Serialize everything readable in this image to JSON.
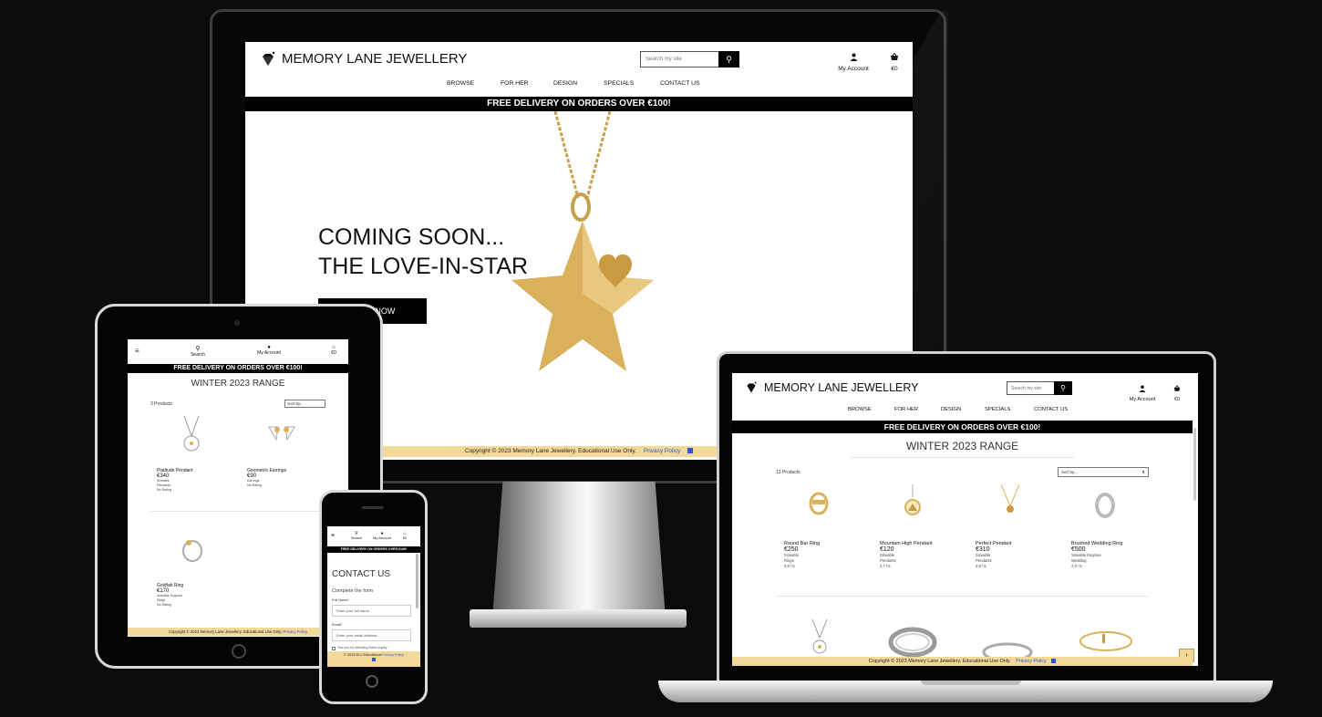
{
  "desktop": {
    "brand": "MEMORY LANE JEWELLERY",
    "search_placeholder": "Search my site",
    "account_label": "My Account",
    "cart_total": "€0",
    "nav": [
      "BROWSE",
      "FOR HER",
      "DESIGN",
      "SPECIALS",
      "CONTACT US"
    ],
    "banner": "FREE DELIVERY ON ORDERS OVER €100!",
    "hero_line1": "COMING SOON...",
    "hero_line2": "THE LOVE-IN-STAR",
    "hero_button": "SHOP NOW",
    "footer_text": "Copyright © 2023 Memory Lane Jewellery.  Educational Use Only.",
    "footer_link": "Privacy Policy"
  },
  "tablet": {
    "search_label": "Search",
    "account_label": "My Account",
    "cart_total": "€0",
    "banner": "FREE DELIVERY ON ORDERS OVER €100!",
    "heading": "WINTER 2023 RANGE",
    "product_count": "3 Products",
    "sort_label": "Sort by...",
    "products": [
      {
        "name": "Platitude Pendant",
        "price": "€340",
        "tags1": "Sizeable",
        "tags2": "Pendants",
        "rating": "No Rating"
      },
      {
        "name": "Geometric Earrings",
        "price": "€90",
        "tags1": "",
        "tags2": "Earrings",
        "rating": "No Rating"
      },
      {
        "name": "Goldfab Ring",
        "price": "€170",
        "tags1": "Sizeable Engrave",
        "tags2": "Rings",
        "rating": "No Rating"
      }
    ],
    "footer_text": "Copyright © 2023 Memory Lane Jewellery.  Educational Use Only.",
    "footer_link": "Privacy Policy"
  },
  "phone": {
    "search_label": "Search",
    "account_label": "My Account",
    "cart_total": "€0",
    "banner": "FREE DELIVERY ON ORDERS OVER €100!",
    "heading": "CONTACT US",
    "subheading": "Complete the form",
    "name_label": "Full Name*",
    "name_placeholder": "Enter your full name",
    "email_label": "Email*",
    "email_placeholder": "Enter your email address",
    "checkbox_label": "Tick box for Wedding Band inquiry",
    "footer_text": "© 2023 MLJ Educational",
    "footer_link": "Privacy Policy"
  },
  "laptop": {
    "brand": "MEMORY LANE JEWELLERY",
    "search_placeholder": "Search my site",
    "account_label": "My Account",
    "cart_total": "€0",
    "nav": [
      "BROWSE",
      "FOR HER",
      "DESIGN",
      "SPECIALS",
      "CONTACT US"
    ],
    "banner": "FREE DELIVERY ON ORDERS OVER €100!",
    "heading": "WINTER 2023 RANGE",
    "product_count": "13 Products",
    "sort_label": "Sort by...",
    "products": [
      {
        "name": "Round Bar Ring",
        "price": "€250",
        "tags1": "Sizeable",
        "tags2": "Rings",
        "rating": "4.8 / 5"
      },
      {
        "name": "Mountain High Pendant",
        "price": "€120",
        "tags1": "Sizeable",
        "tags2": "Pendants",
        "rating": "4.7 / 5"
      },
      {
        "name": "Perfect Pendant",
        "price": "€310",
        "tags1": "Sizeable",
        "tags2": "Pendants",
        "rating": "4.8 / 5"
      },
      {
        "name": "Brushed Wedding Ring",
        "price": "€500",
        "tags1": "Sizeable Engrave",
        "tags2": "Wedding",
        "rating": "4.9 / 5"
      }
    ],
    "footer_text": "Copyright © 2023 Memory Lane Jewellery.  Educational Use Only.",
    "footer_link": "Privacy Policy",
    "back_to_top": "↑"
  },
  "colors": {
    "footer_bg": "#f2d99a",
    "link": "#2b56d8",
    "gold": "#d8b25a",
    "banner_bg": "#000000"
  },
  "icons": [
    "diamond-icon",
    "search-icon",
    "user-icon",
    "basket-icon",
    "hamburger-icon",
    "facebook-icon",
    "arrow-up-icon"
  ]
}
